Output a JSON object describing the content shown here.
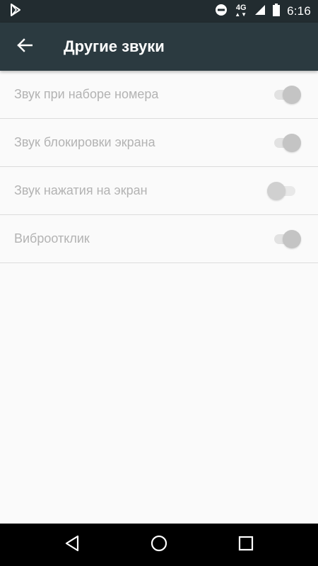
{
  "status_bar": {
    "time": "6:16",
    "network": "4G",
    "icons": [
      "play-store-icon",
      "do-not-disturb-icon",
      "signal-icon",
      "battery-icon"
    ]
  },
  "toolbar": {
    "title": "Другие звуки",
    "back_icon": "arrow-back-icon"
  },
  "settings": [
    {
      "label": "Звук при наборе номера",
      "enabled": true
    },
    {
      "label": "Звук блокировки экрана",
      "enabled": true
    },
    {
      "label": "Звук нажатия на экран",
      "enabled": false
    },
    {
      "label": "Виброотклик",
      "enabled": true
    }
  ],
  "nav_bar": {
    "buttons": [
      "back-triangle-icon",
      "home-circle-icon",
      "recents-square-icon"
    ]
  },
  "colors": {
    "status_bar": "#222c30",
    "toolbar": "#2b3a40",
    "background": "#fafafa",
    "disabled_text": "#b3b3b3",
    "divider": "#dcdcdc"
  }
}
